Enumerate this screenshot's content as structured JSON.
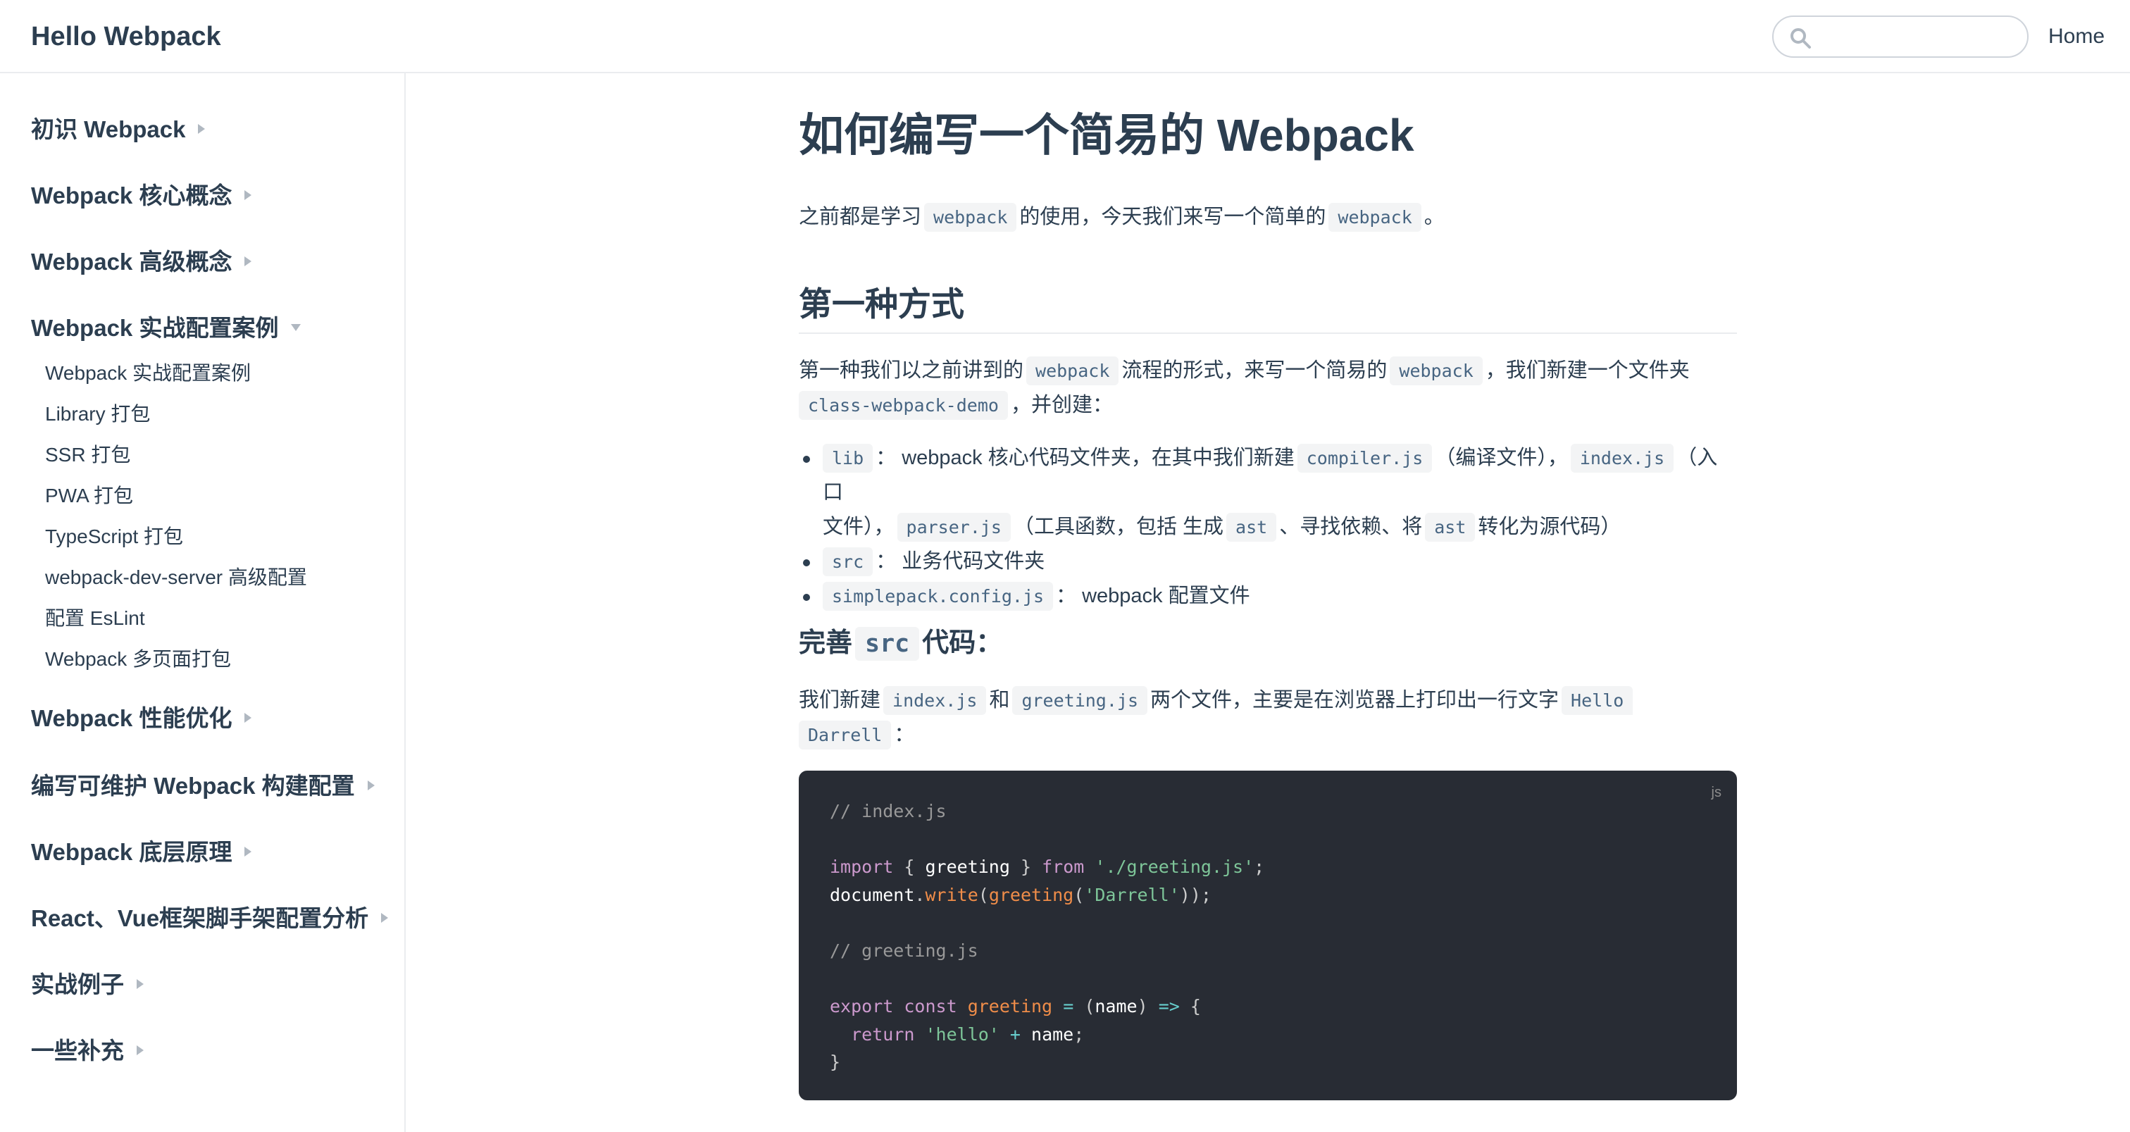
{
  "navbar": {
    "site_name": "Hello Webpack",
    "search_placeholder": "",
    "home_link": "Home"
  },
  "sidebar": {
    "groups": [
      {
        "label": "初识 Webpack",
        "expanded": false
      },
      {
        "label": "Webpack 核心概念",
        "expanded": false
      },
      {
        "label": "Webpack 高级概念",
        "expanded": false
      },
      {
        "label": "Webpack 实战配置案例",
        "expanded": true
      },
      {
        "label": "Webpack 性能优化",
        "expanded": false
      },
      {
        "label": "编写可维护 Webpack 构建配置",
        "expanded": false
      },
      {
        "label": "Webpack 底层原理",
        "expanded": false
      },
      {
        "label": "React、Vue框架脚手架配置分析",
        "expanded": false
      },
      {
        "label": "实战例子",
        "expanded": false
      },
      {
        "label": "一些补充",
        "expanded": false
      }
    ],
    "sub_items": [
      "Webpack 实战配置案例",
      "Library 打包",
      "SSR 打包",
      "PWA 打包",
      "TypeScript 打包",
      "webpack-dev-server 高级配置",
      "配置 EsLint",
      "Webpack 多页面打包"
    ]
  },
  "content": {
    "title": "如何编写一个简易的 Webpack",
    "intro": {
      "t1": "之前都是学习",
      "c1": "webpack",
      "t2": "的使用，今天我们来写一个简单的",
      "c2": "webpack",
      "t3": "。"
    },
    "section1": {
      "heading": "第一种方式",
      "p1": {
        "t1": "第一种我们以之前讲到的",
        "c1": "webpack",
        "t2": "流程的形式，来写一个简易的",
        "c2": "webpack",
        "t3": "，我们新建一个文件夹",
        "c3": "class-webpack-demo",
        "t4": "，并创建："
      },
      "list": {
        "item1": {
          "c1": "lib",
          "t1": "： webpack 核心代码文件夹，在其中我们新建",
          "c2": "compiler.js",
          "t2": "（编译文件），",
          "c3": "index.js",
          "t3": "（入口",
          "t4": "文件），",
          "c4": "parser.js",
          "t5": "（工具函数，包括 生成",
          "c5": "ast",
          "t6": "、寻找依赖、将",
          "c6": "ast",
          "t7": "转化为源代码）"
        },
        "item2": {
          "c1": "src",
          "t1": "： 业务代码文件夹"
        },
        "item3": {
          "c1": "simplepack.config.js",
          "t1": "： webpack 配置文件"
        }
      }
    },
    "section2": {
      "heading_pre": "完善",
      "heading_code": "src",
      "heading_post": "代码：",
      "p1": {
        "t1": "我们新建",
        "c1": "index.js",
        "t2": "和",
        "c2": "greeting.js",
        "t3": "两个文件，主要是在浏览器上打印出一行文字",
        "c3a": "Hello",
        "c3b": "Darrell",
        "t4": "："
      }
    },
    "code_block": {
      "language": "js",
      "lines": [
        "// index.js",
        "",
        "import { greeting } from './greeting.js';",
        "document.write(greeting('Darrell'));",
        "",
        "// greeting.js",
        "",
        "export const greeting = (name) => {",
        "  return 'hello' + name;",
        "}"
      ]
    }
  },
  "colors": {
    "text": "#2c3e50",
    "border": "#eaecef",
    "code_bg": "#282c34",
    "inline_code_bg": "#f3f4f5",
    "inline_code_text": "#476582"
  }
}
